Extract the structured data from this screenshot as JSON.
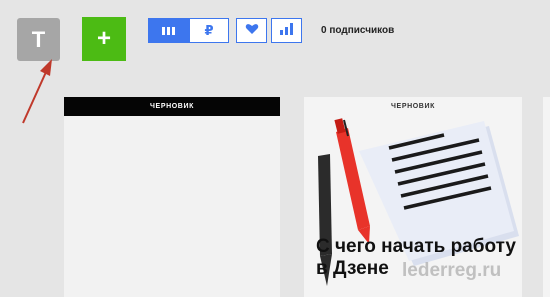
{
  "header": {
    "avatar_letter": "Т",
    "add_label": "+",
    "tabs": [
      {
        "icon": "feed-icon"
      },
      {
        "label": "₽",
        "icon": "ruble-icon"
      },
      {
        "icon": "heart-icon"
      },
      {
        "icon": "stats-icon"
      }
    ],
    "subscribers": "0 подписчиков"
  },
  "cards": [
    {
      "badge": "ЧЕРНОВИК",
      "title": ""
    },
    {
      "badge": "ЧЕРНОВИК",
      "title": "С чего начать работу в Дзене"
    }
  ],
  "watermark": "lederreg.ru",
  "colors": {
    "accent": "#3d76ee",
    "add": "#4cbb14",
    "avatar": "#a6a6a6",
    "arrow": "#c0392b"
  }
}
